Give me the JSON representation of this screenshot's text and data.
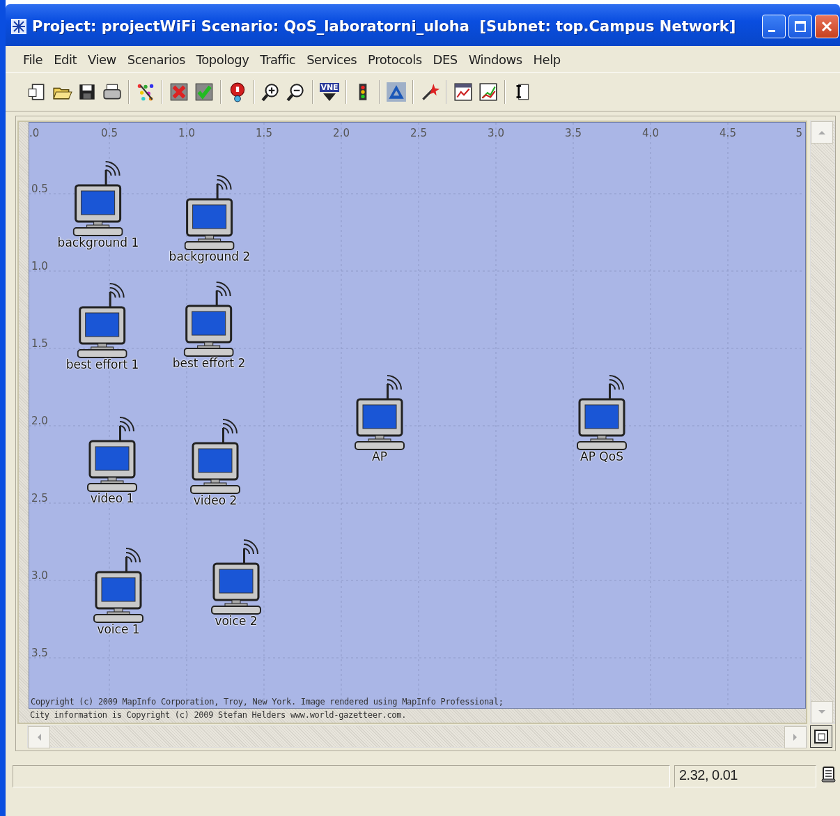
{
  "window": {
    "title": "Project: projectWiFi Scenario: QoS_laboratorni_uloha  [Subnet: top.Campus Network]"
  },
  "menu": [
    {
      "label": "File"
    },
    {
      "label": "Edit"
    },
    {
      "label": "View"
    },
    {
      "label": "Scenarios"
    },
    {
      "label": "Topology"
    },
    {
      "label": "Traffic"
    },
    {
      "label": "Services"
    },
    {
      "label": "Protocols"
    },
    {
      "label": "DES"
    },
    {
      "label": "Windows"
    },
    {
      "label": "Help"
    }
  ],
  "toolbar": {
    "vne_label": "VNE"
  },
  "map": {
    "x_ticks": [
      ".0",
      "0.5",
      "1.0",
      "1.5",
      "2.0",
      "2.5",
      "3.0",
      "3.5",
      "4.0",
      "4.5",
      "5"
    ],
    "y_ticks": [
      "0.5",
      "1.0",
      "1.5",
      "2.0",
      "2.5",
      "3.0",
      "3.5"
    ],
    "nodes": [
      {
        "label": "background 1"
      },
      {
        "label": "background 2"
      },
      {
        "label": "best effort 1"
      },
      {
        "label": "best effort 2"
      },
      {
        "label": "video 1"
      },
      {
        "label": "video 2"
      },
      {
        "label": "voice 1"
      },
      {
        "label": "voice 2"
      },
      {
        "label": "AP"
      },
      {
        "label": "AP QoS"
      }
    ],
    "copyright": [
      "Copyright (c) 2009 MapInfo Corporation, Troy, New York. Image rendered using MapInfo Professional;",
      "City information is Copyright (c) 2009 Stefan Helders www.world-gazetteer.com."
    ]
  },
  "status_bar": {
    "coordinates": "2.32, 0.01"
  }
}
